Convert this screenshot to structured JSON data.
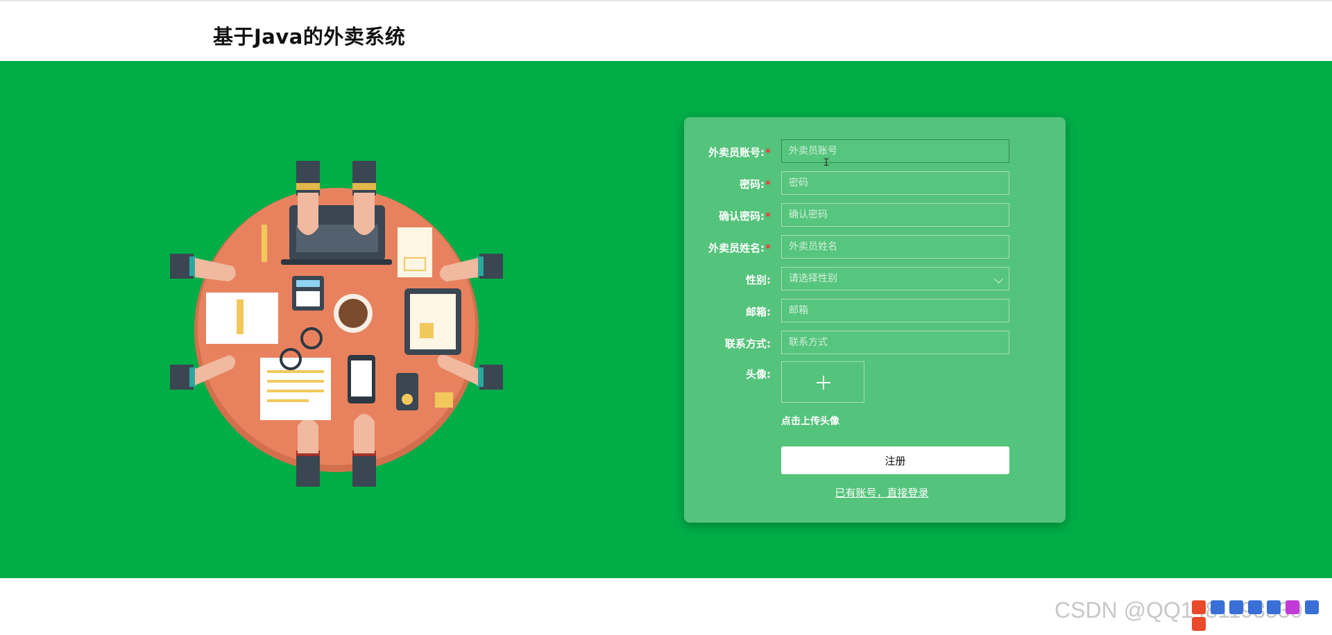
{
  "header": {
    "title": "基于Java的外卖系统"
  },
  "form": {
    "fields": [
      {
        "label": "外卖员账号:",
        "required": true,
        "placeholder": "外卖员账号"
      },
      {
        "label": "密码:",
        "required": true,
        "placeholder": "密码"
      },
      {
        "label": "确认密码:",
        "required": true,
        "placeholder": "确认密码"
      },
      {
        "label": "外卖员姓名:",
        "required": true,
        "placeholder": "外卖员姓名"
      },
      {
        "label": "性别:",
        "required": false,
        "placeholder": "请选择性别"
      },
      {
        "label": "邮箱:",
        "required": false,
        "placeholder": "邮箱"
      },
      {
        "label": "联系方式:",
        "required": false,
        "placeholder": "联系方式"
      }
    ],
    "required_mark": "*",
    "avatar_label": "头像:",
    "upload_plus": "+",
    "upload_hint": "点击上传头像",
    "register_label": "注册",
    "login_link": "已有账号，直接登录"
  },
  "watermark": "CSDN @QQ1481193530",
  "colors": {
    "banner": "#00ad47",
    "panel": "#54c37b",
    "table": "#e8825e"
  },
  "icons": [
    "plus-icon",
    "chevron-down-icon",
    "text-cursor-icon"
  ]
}
